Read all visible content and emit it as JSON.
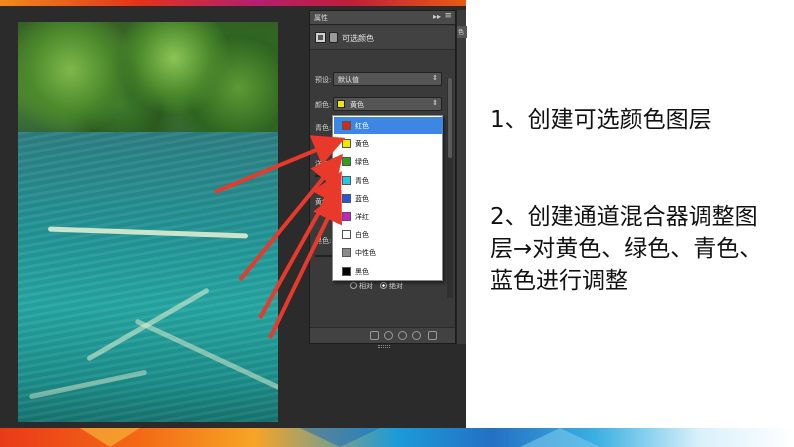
{
  "panel": {
    "tab_label": "属性",
    "tab_controls": "▸▸",
    "menu_icon": "≡",
    "title": "可选颜色",
    "preset_label": "预设:",
    "preset_value": "默认值",
    "color_label": "颜色:",
    "color_value": "黄色",
    "color_value_swatch": "#f2e500",
    "slider_labels": [
      "青色:",
      "洋红:",
      "黄色:",
      "黑色:"
    ],
    "radio_relative": "相对",
    "radio_absolute": "绝对",
    "radio_selected": "absolute"
  },
  "dropdown": {
    "selected_index": 0,
    "items": [
      {
        "label": "红色",
        "swatch": "#d02a1e"
      },
      {
        "label": "黄色",
        "swatch": "#f2e500"
      },
      {
        "label": "绿色",
        "swatch": "#2aa21e"
      },
      {
        "label": "青色",
        "swatch": "#22c6e6"
      },
      {
        "label": "蓝色",
        "swatch": "#1f58d8"
      },
      {
        "label": "洋红",
        "swatch": "#c021c8"
      },
      {
        "label": "白色",
        "swatch": "#ffffff"
      },
      {
        "label": "中性色",
        "swatch": "#8a8a8a"
      },
      {
        "label": "黑色",
        "swatch": "#000000"
      }
    ]
  },
  "dock": {
    "label": "色"
  },
  "text": {
    "step1": "1、创建可选颜色图层",
    "step2": "2、创建通道混合器调整图层→对黄色、绿色、青色、蓝色进行调整"
  },
  "colors": {
    "annotation_arrow": "#e8392b",
    "selection_highlight": "#3d86e4",
    "panel_background": "#3a3a3a"
  }
}
